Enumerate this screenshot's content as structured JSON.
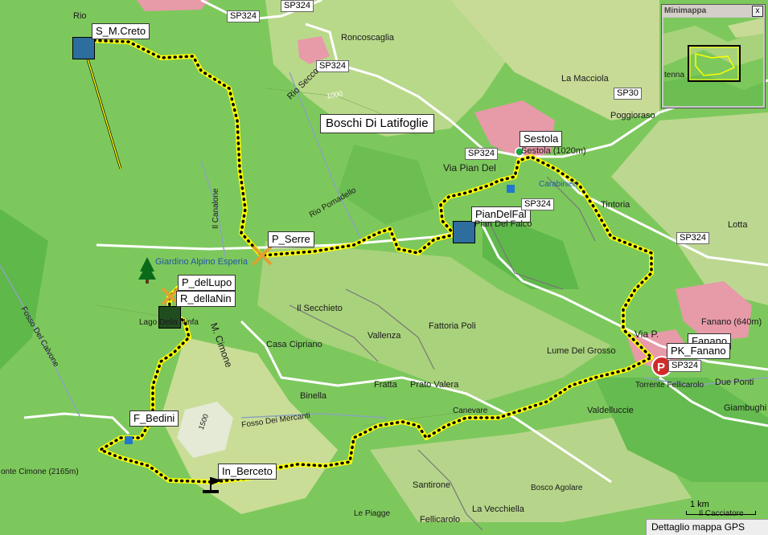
{
  "map": {
    "labels": {
      "roncoscaglia": "Roncoscaglia",
      "la_macciola": "La Macciola",
      "poggioraso": "Poggioraso",
      "rio_secco": "Rio Secco",
      "contour_1000": "1000",
      "boschi": "Boschi Di Latifoglie",
      "sestola_town": "Sestola (1020m)",
      "via_pian_del": "Via Pian Del",
      "pian_del_falco": "Pian Del Falco",
      "carabinieri": "Carabinieri",
      "tintoria": "Tintoria",
      "lotta": "Lotta",
      "rio_pomadello": "Rio Pomadello",
      "il_canalone": "Il Canalone",
      "giardino": "Giardino Alpino Esperia",
      "lago_ninfa": "Lago Della Ninfa",
      "cimone": "M. Cimone",
      "il_secchieto": "Il Secchieto",
      "fattoria_poli": "Fattoria Poli",
      "vallenza": "Vallenza",
      "casa_cipriano": "Casa Cipriano",
      "lume_del_grosso": "Lume Del Grosso",
      "fanano_town": "Fanano (640m)",
      "via_p_fanano": "Via P.",
      "fratta": "Fratta",
      "prato_valera": "Prato Valera",
      "binella": "Binella",
      "fosso_mercanti": "Fosso Dei Mercanti",
      "contour_1500": "1500",
      "torrente": "Torrente Fellicarolo",
      "due_ponti": "Due Ponti",
      "giambughi": "Giambughi",
      "valdelluccie": "Valdelluccie",
      "canevare": "Canevare",
      "fosso_calvone": "Fosso Del Calvone",
      "monte_cimone": "onte Cimone (2165m)",
      "santirone": "Santirone",
      "bosco_agolare": "Bosco Agolare",
      "le_piagge": "Le Piagge",
      "la_vecchiella": "La Vecchiella",
      "fellicarolo": "Fellicarolo",
      "cacciatore": "Il Cacciatore",
      "rio": "Rio",
      "tenna": "tenna"
    },
    "roads": {
      "sp324_top1": "SP324",
      "sp324_top2": "SP324",
      "sp324_top3": "SP324",
      "sp30": "SP30",
      "sp324_sestola": "SP324",
      "sp324_south_sestola": "SP324",
      "sp324_right": "SP324",
      "sp324_fanano": "SP324"
    },
    "waypoints": {
      "s_m_creto": "S_M.Creto",
      "sestola": "Sestola",
      "pian_del_fal": "PianDelFal",
      "p_serre": "P_Serre",
      "p_dellupo": "P_delLupo",
      "r_dellanin": "R_dellaNin",
      "pk_fanano": "PK_Fanano",
      "fanano_wp": "Fanano",
      "f_bedini": "F_Bedini",
      "in_berceto": "In_Berceto"
    },
    "route_color": "#ffff00",
    "route_dot_color": "#000000"
  },
  "minimap": {
    "title": "Minimappa",
    "close_label": "x"
  },
  "scale": {
    "label": "1 km"
  },
  "statusbar": {
    "text": "Dettaglio mappa GPS"
  }
}
